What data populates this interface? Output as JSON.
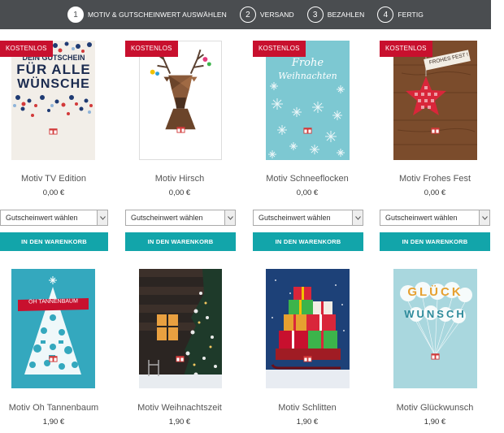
{
  "stepper": {
    "steps": [
      {
        "num": "1",
        "label": "MOTIV & GUTSCHEINWERT AUSWÄHLEN",
        "active": true
      },
      {
        "num": "2",
        "label": "VERSAND",
        "active": false
      },
      {
        "num": "3",
        "label": "BEZAHLEN",
        "active": false
      },
      {
        "num": "4",
        "label": "FERTIG",
        "active": false
      }
    ]
  },
  "badge_label": "KOSTENLOS",
  "select_label": "Gutscheinwert wählen",
  "button_label": "IN DEN WARENKORB",
  "products": [
    {
      "name": "Motiv TV Edition",
      "price": "0,00 €",
      "image_text_1": "DEIN GUTSCHEIN",
      "image_text_2": "FÜR ALLE",
      "image_text_3": "WÜNSCHE"
    },
    {
      "name": "Motiv Hirsch",
      "price": "0,00 €"
    },
    {
      "name": "Motiv Schneeflocken",
      "price": "0,00 €",
      "image_text_1": "Frohe",
      "image_text_2": "Weihnachten"
    },
    {
      "name": "Motiv Frohes Fest",
      "price": "0,00 €",
      "image_text_1": "FROHES FEST !"
    },
    {
      "name": "Motiv Oh Tannenbaum",
      "price": "1,90 €",
      "image_text_1": "OH TANNENBAUM"
    },
    {
      "name": "Motiv Weihnachtszeit",
      "price": "1,90 €"
    },
    {
      "name": "Motiv Schlitten",
      "price": "1,90 €"
    },
    {
      "name": "Motiv Glückwunsch",
      "price": "1,90 €",
      "image_text_1": "GLÜCK",
      "image_text_2": "WUNSCH"
    }
  ],
  "colors": {
    "header_bg": "#4a4d50",
    "badge": "#c8102e",
    "button": "#12a5aa"
  }
}
